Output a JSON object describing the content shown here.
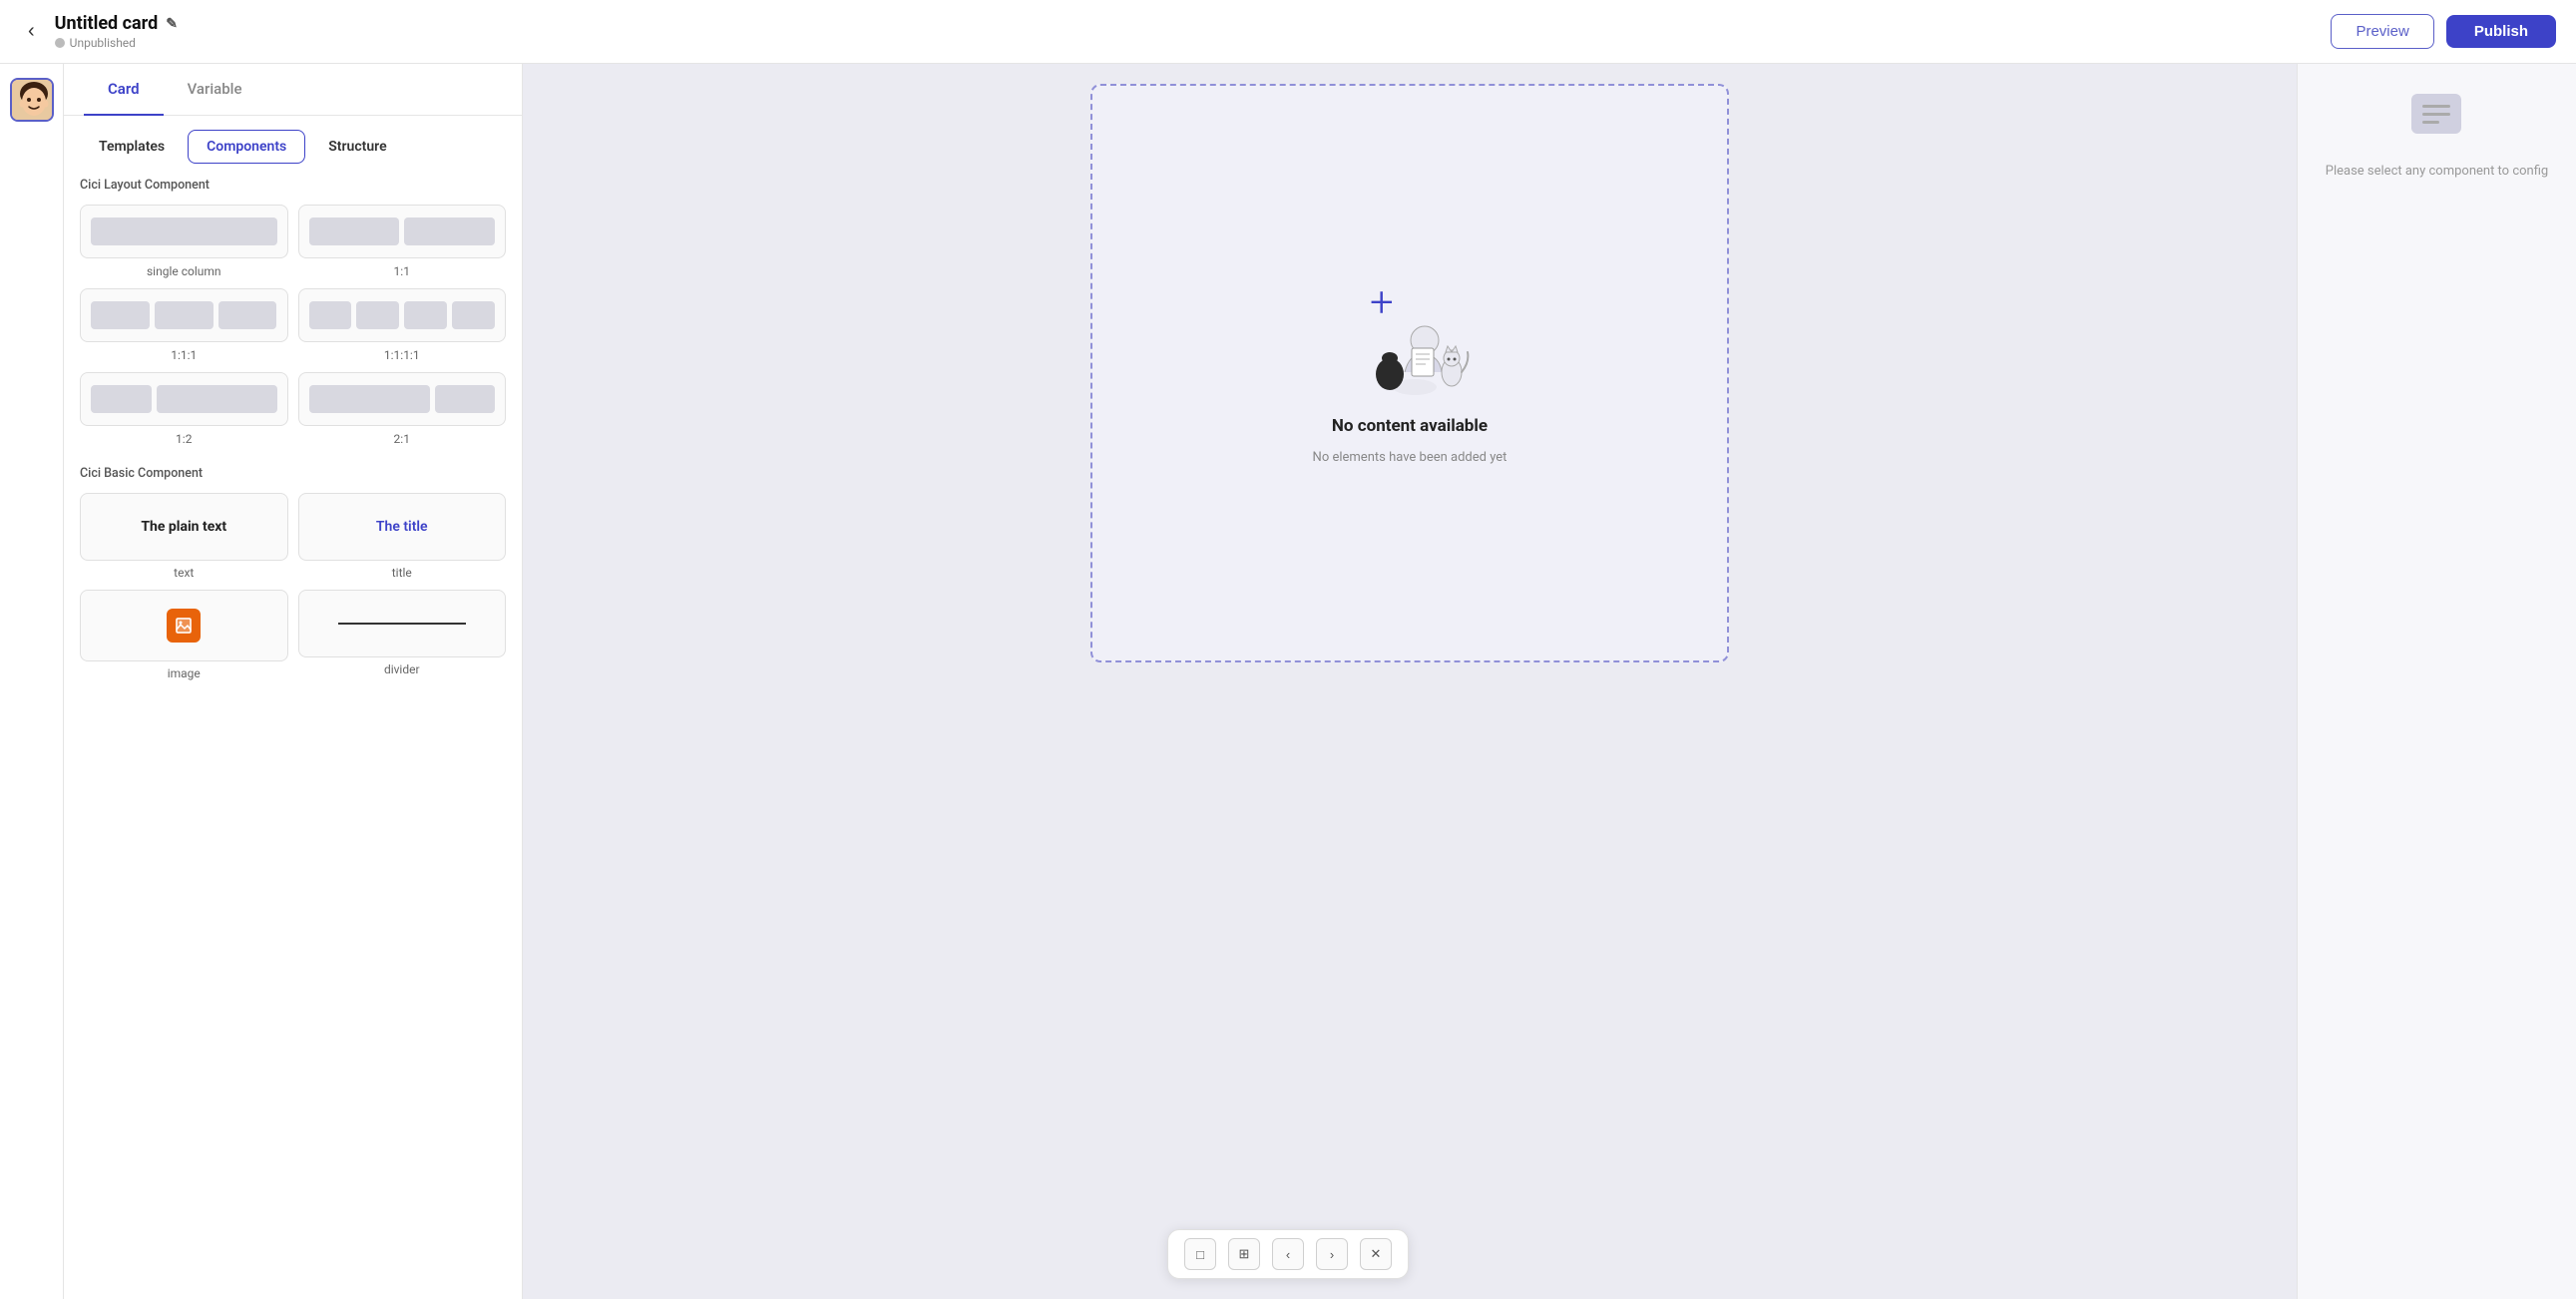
{
  "header": {
    "back_label": "‹",
    "title": "Untitled card",
    "edit_icon": "✎",
    "status": "Unpublished",
    "status_dot_color": "#bbbbbb",
    "preview_label": "Preview",
    "publish_label": "Publish"
  },
  "tabs": {
    "top": [
      {
        "id": "card",
        "label": "Card",
        "active": true
      },
      {
        "id": "variable",
        "label": "Variable",
        "active": false
      }
    ],
    "sub": [
      {
        "id": "templates",
        "label": "Templates",
        "active": false
      },
      {
        "id": "components",
        "label": "Components",
        "active": true
      },
      {
        "id": "structure",
        "label": "Structure",
        "active": false
      }
    ]
  },
  "sections": {
    "layout": {
      "label": "Cici Layout Component",
      "items": [
        {
          "id": "single-column",
          "label": "single column",
          "cols": [
            1
          ]
        },
        {
          "id": "1-1",
          "label": "1:1",
          "cols": [
            1,
            1
          ]
        },
        {
          "id": "1-1-1",
          "label": "1:1:1",
          "cols": [
            1,
            1,
            1
          ]
        },
        {
          "id": "1-1-1-1",
          "label": "1:1:1:1",
          "cols": [
            1,
            1,
            1,
            1
          ]
        },
        {
          "id": "1-2",
          "label": "1:2",
          "cols": [
            1,
            2
          ]
        },
        {
          "id": "2-1",
          "label": "2:1",
          "cols": [
            2,
            1
          ]
        }
      ]
    },
    "basic": {
      "label": "Cici Basic Component",
      "items": [
        {
          "id": "text",
          "label": "text",
          "type": "text",
          "preview": "The plain text"
        },
        {
          "id": "title",
          "label": "title",
          "type": "title",
          "preview": "The title"
        },
        {
          "id": "image",
          "label": "image",
          "type": "image",
          "preview": "🖼"
        },
        {
          "id": "divider",
          "label": "divider",
          "type": "divider",
          "preview": ""
        }
      ]
    }
  },
  "canvas": {
    "empty_title": "No content available",
    "empty_subtitle": "No elements have been added yet"
  },
  "right_panel": {
    "placeholder_text": "Please select any component to config"
  },
  "bottom_toolbar": {
    "buttons": [
      "□",
      "⊞",
      "‹",
      "›",
      "✕"
    ]
  }
}
